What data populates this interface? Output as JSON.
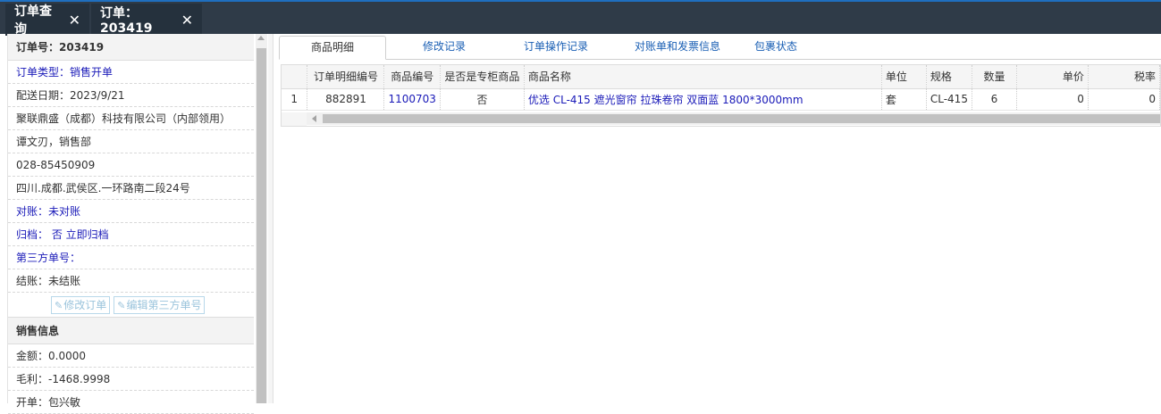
{
  "top_tabs": [
    {
      "label": "订单查询",
      "close": "✕"
    },
    {
      "label": "订单：203419",
      "close": "✕"
    }
  ],
  "left": {
    "order_no": "订单号：203419",
    "rows": [
      "订单类型：销售开单",
      "配送日期：2023/9/21",
      "聚联鼎盛（成都）科技有限公司（内部领用）",
      "谭文刃，销售部",
      "028-85450909",
      "四川.成都.武侯区.一环路南二段24号",
      "对账：未对账",
      "归档： 否 立即归档",
      "第三方单号：",
      "结账：未结账"
    ],
    "buttons": {
      "edit_order": "修改订单",
      "edit_third": "编辑第三方单号"
    },
    "sales_section": "销售信息",
    "sales_rows": [
      "金额：0.0000",
      "毛利：-1468.9998",
      "开单：包兴敏"
    ]
  },
  "tabs": [
    "商品明细",
    "修改记录",
    "订单操作记录",
    "对账单和发票信息",
    "包裹状态"
  ],
  "table": {
    "headers": [
      "",
      "订单明细编号",
      "商品编号",
      "是否是专柜商品",
      "商品名称",
      "单位",
      "规格",
      "数量",
      "单价",
      "税率"
    ],
    "rows": [
      [
        "1",
        "882891",
        "1100703",
        "否",
        "优选 CL-415 遮光窗帘 拉珠卷帘 双面蓝 1800*3000mm",
        "套",
        "CL-415",
        "6",
        "0",
        "0"
      ]
    ]
  },
  "colors": {
    "topbar": "#2f3b48",
    "accent": "#1f6fbf",
    "link": "#1a1ab8"
  }
}
